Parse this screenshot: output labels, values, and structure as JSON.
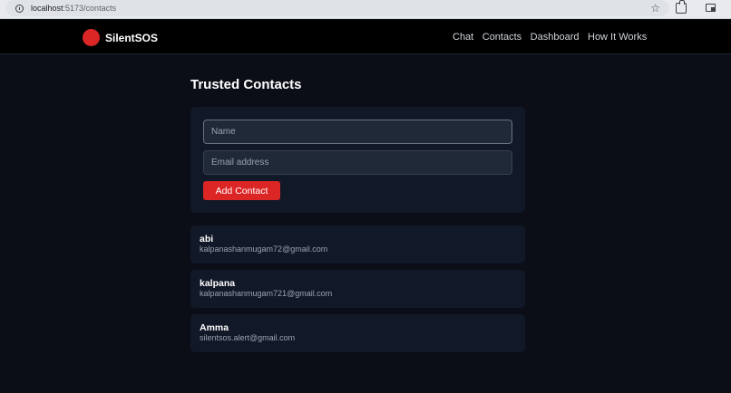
{
  "browser": {
    "url_host": "localhost",
    "url_path": ":5173/contacts"
  },
  "nav": {
    "brand": "SilentSOS",
    "links": [
      "Chat",
      "Contacts",
      "Dashboard",
      "How It Works"
    ]
  },
  "page": {
    "title": "Trusted Contacts"
  },
  "form": {
    "name_placeholder": "Name",
    "email_placeholder": "Email address",
    "add_label": "Add Contact"
  },
  "contacts": [
    {
      "name": "abi",
      "email": "kalpanashanmugam72@gmail.com"
    },
    {
      "name": "kalpana",
      "email": "kalpanashanmugam721@gmail.com"
    },
    {
      "name": "Amma",
      "email": "silentsos.alert@gmail.com"
    }
  ],
  "colors": {
    "accent": "#dc2626",
    "background": "#0b0e16",
    "card": "#111827"
  }
}
